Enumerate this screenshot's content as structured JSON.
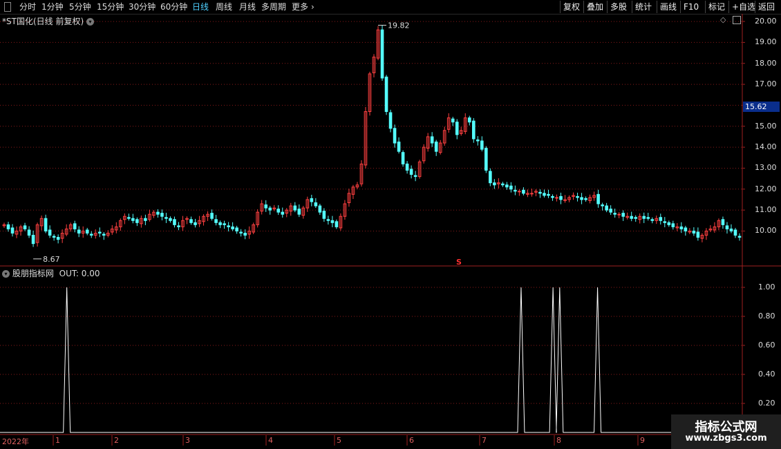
{
  "toolbar": {
    "periods": [
      "分时",
      "1分钟",
      "5分钟",
      "15分钟",
      "30分钟",
      "60分钟",
      "日线",
      "周线",
      "月线",
      "多周期",
      "更多"
    ],
    "active_period": "日线",
    "more_arrow": "›",
    "tools": [
      "复权",
      "叠加",
      "多股",
      "统计",
      "画线",
      "F10",
      "标记",
      "+自选",
      "返回"
    ]
  },
  "main_panel": {
    "title": "*ST国化(日线 前复权)",
    "price_labels": [
      "20.00",
      "19.00",
      "18.00",
      "17.00",
      "16.00",
      "15.00",
      "14.00",
      "13.00",
      "12.00",
      "11.00",
      "10.00"
    ],
    "current_price": "15.62",
    "high_label": "19.82",
    "low_label": "8.67",
    "marker": "S"
  },
  "indicator_panel": {
    "title": "股朋指标网",
    "out_label": "OUT: 0.00",
    "scale_labels": [
      "1.00",
      "0.80",
      "0.60",
      "0.40",
      "0.20"
    ]
  },
  "time_axis": {
    "year": "2022年",
    "months": [
      "1",
      "2",
      "3",
      "4",
      "5",
      "6",
      "7",
      "8",
      "9"
    ]
  },
  "watermark": {
    "line1": "指标公式网",
    "line2": "www.zbgs3.com"
  },
  "colors": {
    "up": "#ff4040",
    "down": "#54ffff",
    "active_tab": "#4fd0ff",
    "grid": "#8b1a1a",
    "current_price_bg": "#0a2e8c"
  },
  "chart_data": [
    {
      "type": "candlestick",
      "series": [
        {
          "name": "*ST国化",
          "close": [
            10.3,
            10.1,
            9.9,
            10.0,
            10.2,
            10.1,
            9.8,
            9.4,
            10.3,
            10.6,
            10.0,
            9.8,
            9.7,
            9.6,
            9.9,
            10.1,
            10.3,
            10.1,
            9.9,
            10.0,
            9.9,
            9.8,
            9.9,
            9.9,
            9.8,
            9.9,
            10.1,
            10.2,
            10.5,
            10.7,
            10.6,
            10.5,
            10.4,
            10.6,
            10.5,
            10.8,
            10.9,
            10.8,
            10.7,
            10.6,
            10.5,
            10.3,
            10.2,
            10.5,
            10.6,
            10.4,
            10.3,
            10.5,
            10.7,
            10.8,
            10.6,
            10.4,
            10.3,
            10.3,
            10.2,
            10.1,
            10.0,
            9.9,
            9.8,
            10.0,
            10.3,
            10.9,
            11.3,
            11.1,
            11.0,
            11.1,
            10.9,
            10.8,
            11.0,
            11.2,
            11.0,
            10.8,
            11.1,
            11.5,
            11.4,
            11.2,
            10.9,
            10.6,
            10.5,
            10.4,
            10.2,
            10.7,
            11.3,
            11.8,
            12.1,
            12.2,
            13.2,
            15.7,
            17.5,
            18.3,
            19.6,
            17.3,
            15.7,
            14.9,
            14.2,
            13.8,
            13.2,
            12.9,
            12.7,
            12.6,
            13.3,
            14.0,
            14.5,
            14.2,
            13.8,
            14.2,
            14.8,
            15.4,
            15.2,
            14.6,
            14.8,
            15.4,
            15.2,
            14.4,
            14.3,
            13.9,
            12.9,
            12.3,
            12.2,
            12.3,
            12.2,
            12.1,
            12.0,
            11.9,
            11.9,
            11.8,
            11.8,
            11.8,
            11.9,
            11.8,
            11.7,
            11.7,
            11.6,
            11.6,
            11.5,
            11.5,
            11.6,
            11.7,
            11.6,
            11.5,
            11.5,
            11.6,
            11.7,
            11.3,
            11.2,
            11.0,
            10.9,
            10.8,
            10.8,
            10.7,
            10.7,
            10.6,
            10.6,
            10.7,
            10.6,
            10.6,
            10.5,
            10.6,
            10.5,
            10.4,
            10.3,
            10.2,
            10.2,
            10.1,
            10.0,
            10.0,
            9.9,
            9.7,
            9.8,
            10.0,
            10.1,
            10.2,
            10.5,
            10.3,
            10.1,
            10.0,
            9.8,
            9.7
          ]
        }
      ],
      "ylim": [
        8.4,
        20.2
      ]
    },
    {
      "type": "line",
      "series": [
        {
          "name": "OUT",
          "spikes": [
            {
              "x_pct": 9.0,
              "value": 1.0
            },
            {
              "x_pct": 70.2,
              "value": 1.0
            },
            {
              "x_pct": 74.5,
              "value": 1.0
            },
            {
              "x_pct": 75.4,
              "value": 1.0
            },
            {
              "x_pct": 80.5,
              "value": 1.0
            }
          ]
        }
      ],
      "ylim": [
        0,
        1.1
      ]
    }
  ]
}
